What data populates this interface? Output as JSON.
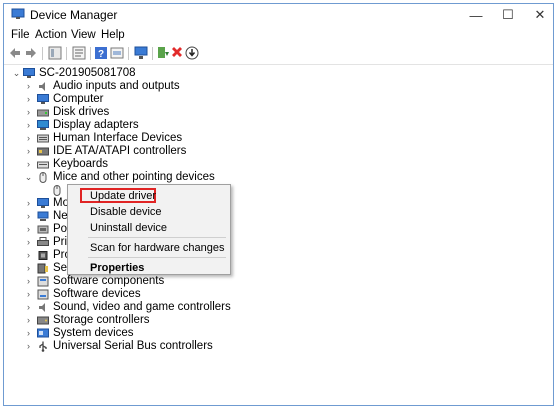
{
  "window": {
    "title": "Device Manager",
    "minimize": "—",
    "maximize": "☐",
    "close": "✕"
  },
  "menu": [
    "File",
    "Action",
    "View",
    "Help"
  ],
  "toolbar_icons": [
    "back-icon",
    "forward-icon",
    "show-hide-icon",
    "properties-icon",
    "help-icon",
    "action-icon",
    "scan-icon",
    "update-driver-icon",
    "uninstall-icon",
    "install-icon"
  ],
  "tree": {
    "root": "SC-201905081708",
    "items": [
      "Audio inputs and outputs",
      "Computer",
      "Disk drives",
      "Display adapters",
      "Human Interface Devices",
      "IDE ATA/ATAPI controllers",
      "Keyboards",
      "Mice and other pointing devices",
      "",
      "Mo",
      "Net",
      "Por",
      "Prin",
      "Pro",
      "Sec",
      "Software components",
      "Software devices",
      "Sound, video and game controllers",
      "Storage controllers",
      "System devices",
      "Universal Serial Bus controllers"
    ]
  },
  "context_menu": {
    "update": "Update driver",
    "disable": "Disable device",
    "uninstall": "Uninstall device",
    "scan": "Scan for hardware changes",
    "properties": "Properties"
  },
  "colors": {
    "highlight_border": "#e02424",
    "window_border": "#6f9bd1"
  }
}
